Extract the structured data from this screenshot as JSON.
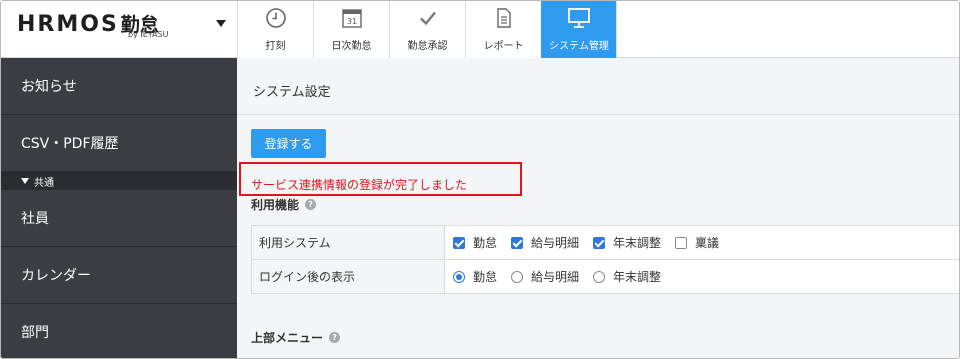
{
  "header": {
    "logo_main": "HRMOS",
    "logo_suffix": "勤怠",
    "logo_sub": "by IEYASU",
    "tabs": [
      {
        "label": "打刻",
        "icon": "clock-icon"
      },
      {
        "label": "日次勤怠",
        "icon": "calendar-icon"
      },
      {
        "label": "勤怠承認",
        "icon": "checkmark-icon"
      },
      {
        "label": "レポート",
        "icon": "document-icon"
      },
      {
        "label": "システム管理",
        "icon": "monitor-icon",
        "active": true
      }
    ],
    "calendar_day": "31"
  },
  "sidebar": {
    "items": [
      {
        "label": "お知らせ"
      },
      {
        "label": "CSV・PDF履歴"
      }
    ],
    "group_label": "共通",
    "group_items": [
      {
        "label": "社員"
      },
      {
        "label": "カレンダー"
      },
      {
        "label": "部門"
      }
    ]
  },
  "main": {
    "page_title": "システム設定",
    "register_button": "登録する",
    "notice": "サービス連携情報の登録が完了しました",
    "features_title": "利用機能",
    "rows": [
      {
        "label": "利用システム",
        "type": "checkbox",
        "options": [
          {
            "label": "勤怠",
            "checked": true
          },
          {
            "label": "給与明細",
            "checked": true
          },
          {
            "label": "年末調整",
            "checked": true
          },
          {
            "label": "稟議",
            "checked": false
          }
        ]
      },
      {
        "label": "ログイン後の表示",
        "type": "radio",
        "options": [
          {
            "label": "勤怠",
            "checked": true
          },
          {
            "label": "給与明細",
            "checked": false
          },
          {
            "label": "年末調整",
            "checked": false
          }
        ]
      }
    ],
    "top_menu_title": "上部メニュー",
    "help_glyph": "?"
  },
  "colors": {
    "accent": "#2f9bee",
    "sidebar_bg": "#3a3d42",
    "notice_red": "#e0161d",
    "check_blue": "#2f78d8"
  }
}
